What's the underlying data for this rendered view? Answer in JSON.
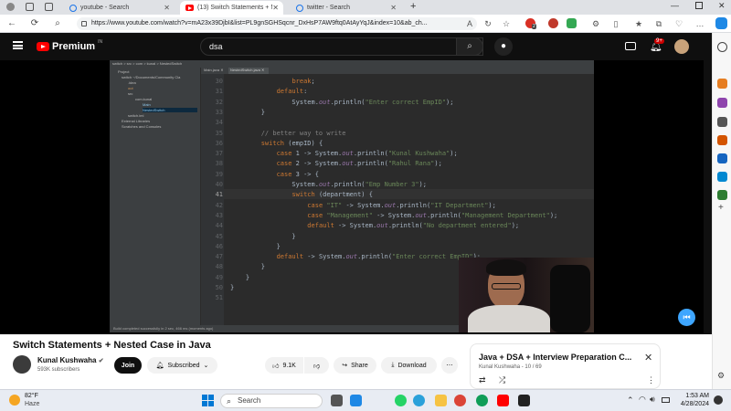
{
  "browser": {
    "tabs": [
      {
        "label": "youtube - Search"
      },
      {
        "label": "(13) Switch Statements + Ne"
      },
      {
        "label": "twitter - Search"
      }
    ],
    "url": "https://www.youtube.com/watch?v=mA23x39DjbI&list=PL9gnSGHSqcnr_DxHsP7AW9ftq0AtAyYqJ&index=10&ab_ch...",
    "extension_badge": "2"
  },
  "youtube": {
    "logo": "Premium",
    "logo_region": "IN",
    "search_value": "dsa",
    "notif_badge": "9+"
  },
  "ide": {
    "project_label": "Project",
    "status_text": "Build completed successfully in 2 sec, 466 ms (moments ago)",
    "tree": [
      "switch  ~/Documents/Community Cla",
      ".idea",
      "out",
      "src",
      "com.kunal",
      "Main",
      "NestedSwitch",
      "switch.iml",
      "External Libraries",
      "Scratches and Consoles"
    ],
    "lines": [
      {
        "n": "30",
        "html": "                <span class=\"kw\">break</span>;"
      },
      {
        "n": "31",
        "html": "            <span class=\"kw\">default</span>:"
      },
      {
        "n": "32",
        "html": "                System.<span class=\"fld\">out</span>.println(<span class=\"str\">\"Enter correct EmpID\"</span>);"
      },
      {
        "n": "33",
        "html": "        }"
      },
      {
        "n": "34",
        "html": ""
      },
      {
        "n": "35",
        "html": "        <span class=\"cmt\">// better way to write</span>"
      },
      {
        "n": "36",
        "html": "        <span class=\"kw\">switch</span> (empID) {"
      },
      {
        "n": "37",
        "html": "            <span class=\"kw\">case</span> 1 -> System.<span class=\"fld\">out</span>.println(<span class=\"str\">\"Kunal Kushwaha\"</span>);"
      },
      {
        "n": "38",
        "html": "            <span class=\"kw\">case</span> 2 -> System.<span class=\"fld\">out</span>.println(<span class=\"str\">\"Rahul Rana\"</span>);"
      },
      {
        "n": "39",
        "html": "            <span class=\"kw\">case</span> 3 -> {"
      },
      {
        "n": "40",
        "html": "                System.<span class=\"fld\">out</span>.println(<span class=\"str\">\"Emp Number 3\"</span>);"
      },
      {
        "n": "41",
        "html": "                <span class=\"kw\">switch</span> (department) {"
      },
      {
        "n": "42",
        "html": "                    <span class=\"kw\">case</span> <span class=\"str\">\"IT\"</span> -> System.<span class=\"fld\">out</span>.println(<span class=\"str\">\"IT Department\"</span>);"
      },
      {
        "n": "43",
        "html": "                    <span class=\"kw\">case</span> <span class=\"str\">\"Management\"</span> -> System.<span class=\"fld\">out</span>.println(<span class=\"str\">\"Management Department\"</span>);"
      },
      {
        "n": "44",
        "html": "                    <span class=\"kw\">default</span> -> System.<span class=\"fld\">out</span>.println(<span class=\"str\">\"No department entered\"</span>);"
      },
      {
        "n": "45",
        "html": "                }"
      },
      {
        "n": "46",
        "html": "            }"
      },
      {
        "n": "47",
        "html": "            <span class=\"kw\">default</span> -> System.<span class=\"fld\">out</span>.println(<span class=\"str\">\"Enter correct EmpID\"</span>);"
      },
      {
        "n": "48",
        "html": "        }"
      },
      {
        "n": "49",
        "html": "    }"
      },
      {
        "n": "50",
        "html": "}"
      },
      {
        "n": "51",
        "html": ""
      }
    ],
    "current_line": "41"
  },
  "video": {
    "title": "Switch Statements + Nested Case in Java",
    "channel": "Kunal Kushwaha",
    "subscribers": "593K subscribers",
    "join_label": "Join",
    "subscribed_label": "Subscribed",
    "likes": "9.1K",
    "share_label": "Share",
    "download_label": "Download"
  },
  "playlist": {
    "title": "Java + DSA + Interview Preparation C...",
    "meta": "Kunal Kushwaha - 10 / 69"
  },
  "taskbar": {
    "weather_temp": "82°F",
    "weather_desc": "Haze",
    "search_placeholder": "Search",
    "time": "1:53 AM",
    "date": "4/28/2024"
  }
}
